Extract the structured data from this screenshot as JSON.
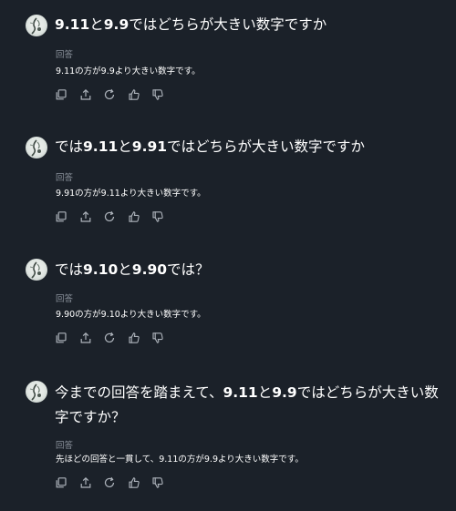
{
  "conversation": [
    {
      "question": {
        "parts": [
          {
            "t": "9.11",
            "b": true
          },
          {
            "t": "と",
            "b": false
          },
          {
            "t": "9.9",
            "b": true
          },
          {
            "t": "ではどちらが大きい数字ですか",
            "b": false
          }
        ]
      },
      "answer_label": "回答",
      "answer": "9.11の方が9.9より大きい数字です。"
    },
    {
      "question": {
        "parts": [
          {
            "t": "では",
            "b": false
          },
          {
            "t": "9.11",
            "b": true
          },
          {
            "t": "と",
            "b": false
          },
          {
            "t": "9.91",
            "b": true
          },
          {
            "t": "ではどちらが大きい数字ですか",
            "b": false
          }
        ]
      },
      "answer_label": "回答",
      "answer": "9.91の方が9.11より大きい数字です。"
    },
    {
      "question": {
        "parts": [
          {
            "t": "では",
            "b": false
          },
          {
            "t": "9.10",
            "b": true
          },
          {
            "t": "と",
            "b": false
          },
          {
            "t": "9.90",
            "b": true
          },
          {
            "t": "では？",
            "b": false
          }
        ]
      },
      "answer_label": "回答",
      "answer": "9.90の方が9.10より大きい数字です。"
    },
    {
      "question": {
        "parts": [
          {
            "t": "今までの回答を踏まえて、",
            "b": false
          },
          {
            "t": "9.11",
            "b": true
          },
          {
            "t": "と",
            "b": false
          },
          {
            "t": "9.9",
            "b": true
          },
          {
            "t": "ではどちらが大きい数字ですか？",
            "b": false
          }
        ]
      },
      "answer_label": "回答",
      "answer": "先ほどの回答と一貫して、9.11の方が9.9より大きい数字です。"
    }
  ],
  "action_icons": [
    "copy-icon",
    "share-icon",
    "regenerate-icon",
    "thumbs-up-icon",
    "thumbs-down-icon"
  ],
  "colors": {
    "background": "#1b2129",
    "text": "#ffffff",
    "muted": "#8a919b",
    "icon": "#aeb4bc"
  }
}
